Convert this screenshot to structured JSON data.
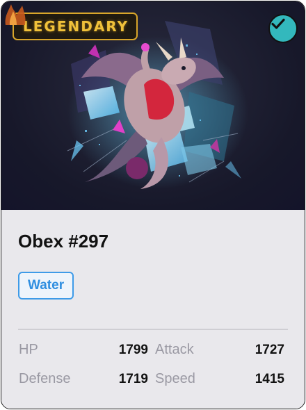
{
  "card": {
    "rarity": "LEGENDARY",
    "name": "Obex #297",
    "type": "Water",
    "verified": true,
    "colors": {
      "rarity_gold": "#f0c13a",
      "verified_teal": "#33b8bd",
      "type_blue": "#3e9be8"
    },
    "icons": {
      "rarity": "flame-icon",
      "verified": "checkmark-icon"
    }
  },
  "stats": {
    "hp_label": "HP",
    "hp_value": "1799",
    "attack_label": "Attack",
    "attack_value": "1727",
    "defense_label": "Defense",
    "defense_value": "1719",
    "speed_label": "Speed",
    "speed_value": "1415"
  }
}
